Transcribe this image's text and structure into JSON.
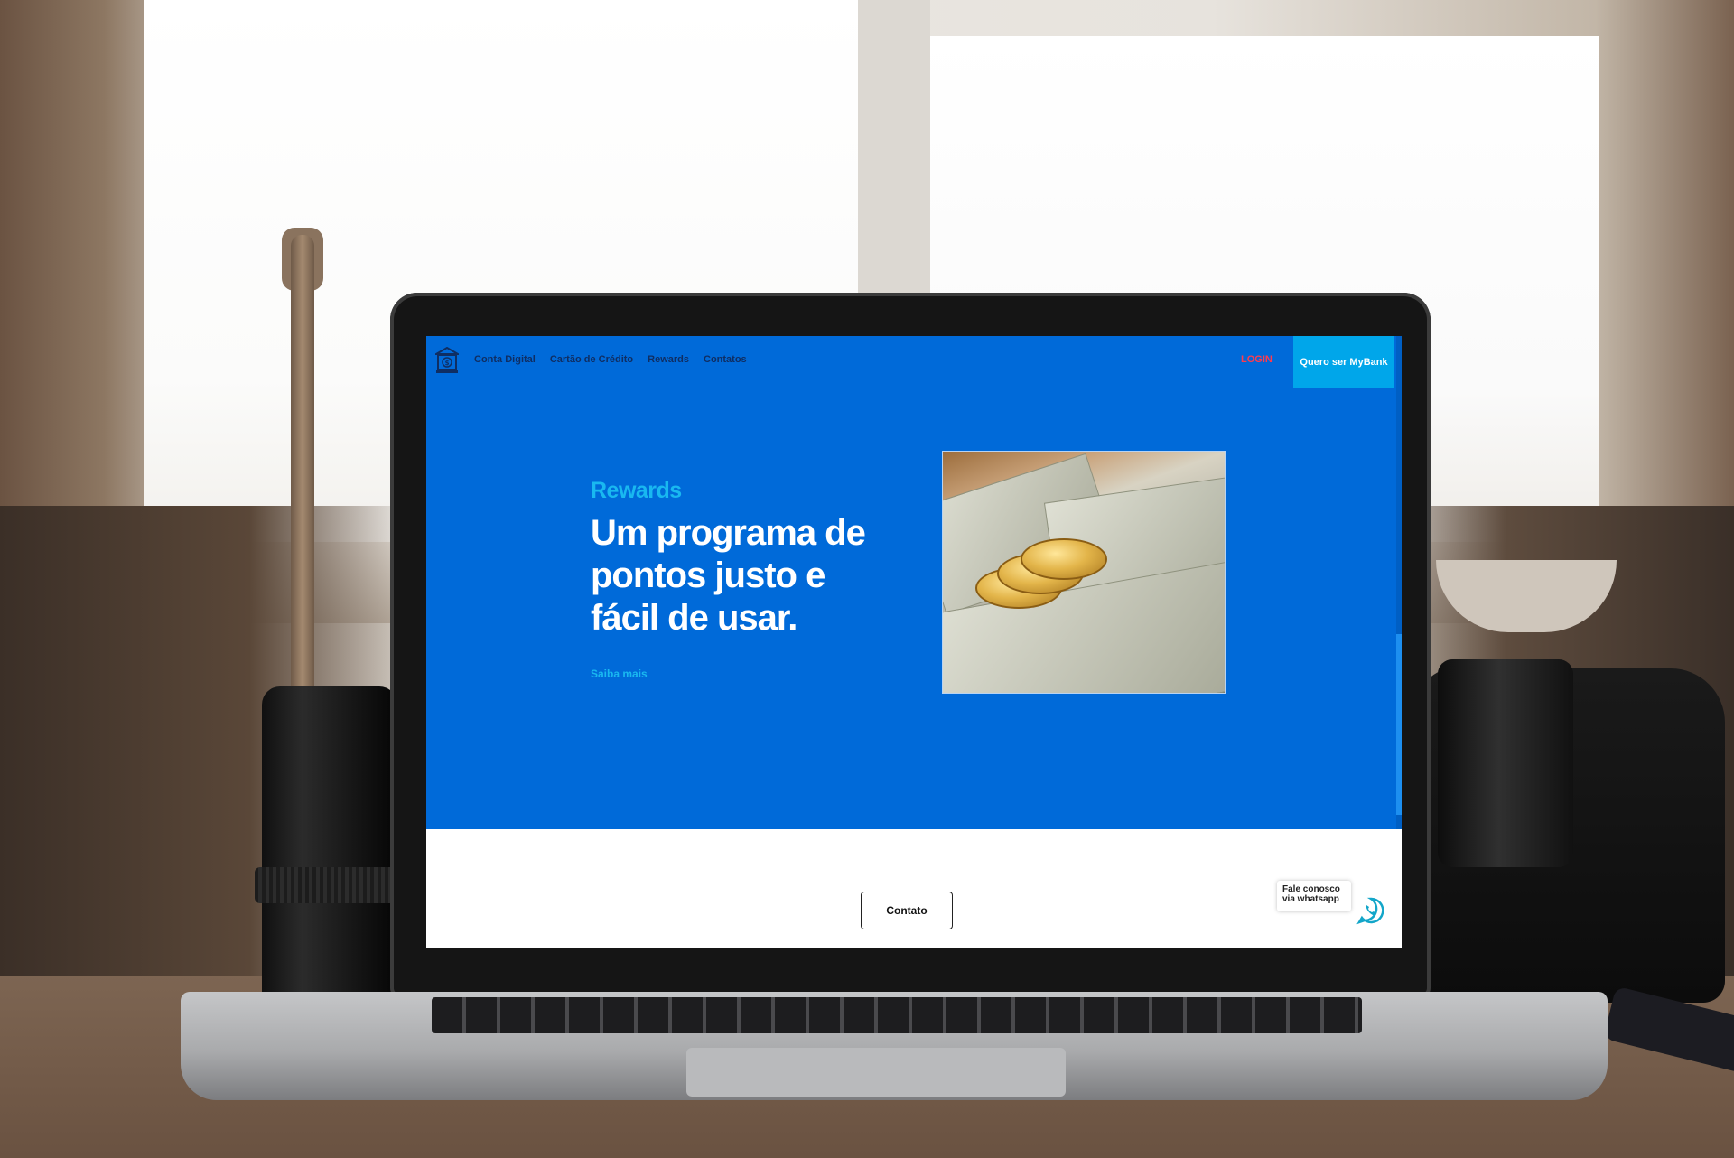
{
  "navbar": {
    "logo_icon": "bank-icon",
    "links": [
      "Conta Digital",
      "Cartão de Crédito",
      "Rewards",
      "Contatos"
    ],
    "login_label": "LOGIN",
    "cta_label": "Quero ser MyBank"
  },
  "hero": {
    "eyebrow": "Rewards",
    "headline": "Um programa de pontos justo e fácil de usar.",
    "link_label": "Saiba mais",
    "image_icon": "coins-on-dollar-bills-photo"
  },
  "footer": {
    "contact_button_label": "Contato",
    "whatsapp_label_line1": "Fale conosco",
    "whatsapp_label_line2": "via whatsapp",
    "whatsapp_icon": "whatsapp-icon"
  },
  "colors": {
    "primary": "#006ad9",
    "accent": "#19b8f0",
    "cta_bg": "#00a6ea",
    "login": "#ff3b4e",
    "nav_text": "#0f2e63"
  }
}
